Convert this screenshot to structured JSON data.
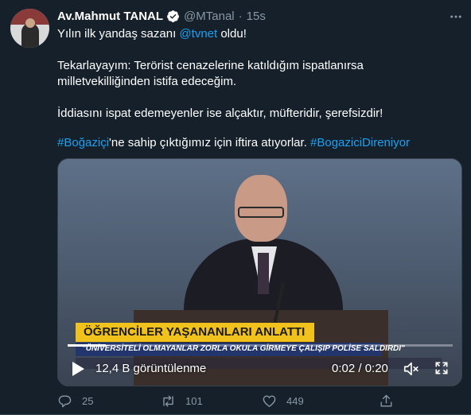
{
  "tweet": {
    "author_name": "Av.Mahmut TANAL",
    "handle": "@MTanal",
    "separator": "·",
    "time": "15s",
    "line1_prefix": "Yılın ilk yandaş sazanı ",
    "line1_mention": "@tvnet",
    "line1_suffix": " oldu!",
    "line2": "Tekarlayayım: Terörist cenazelerine katıldığım ispatlanırsa",
    "line3": "milletvekilliğinden istifa edeceğim.",
    "line4": "İddiasını ispat edemeyenler ise alçaktır, müfteridir, şerefsizdir!",
    "hashtag1": "#Boğaziçi",
    "line5_middle": "'ne sahip çıktığımız için iftira atıyorlar. ",
    "hashtag2": "#BogaziciDireniyor"
  },
  "video": {
    "banner_title": "ÖĞRENCİLER YAŞANANLARI ANLATTI",
    "banner_subtitle": "\"ÜNİVERSİTELİ OLMAYANLAR ZORLA OKULA GİRMEYE ÇALIŞIP POLİSE SALDIRDI\"",
    "views": "12,4 B görüntülenme",
    "timecode": "0:02 / 0:20",
    "progress_fraction": 0.1
  },
  "actions": {
    "replies": "25",
    "retweets": "101",
    "likes": "449"
  },
  "colors": {
    "background": "#15202b",
    "accent": "#1da1f2",
    "muted": "#8899a6",
    "banner_yellow": "#f1c21b",
    "banner_blue": "#23356d"
  }
}
